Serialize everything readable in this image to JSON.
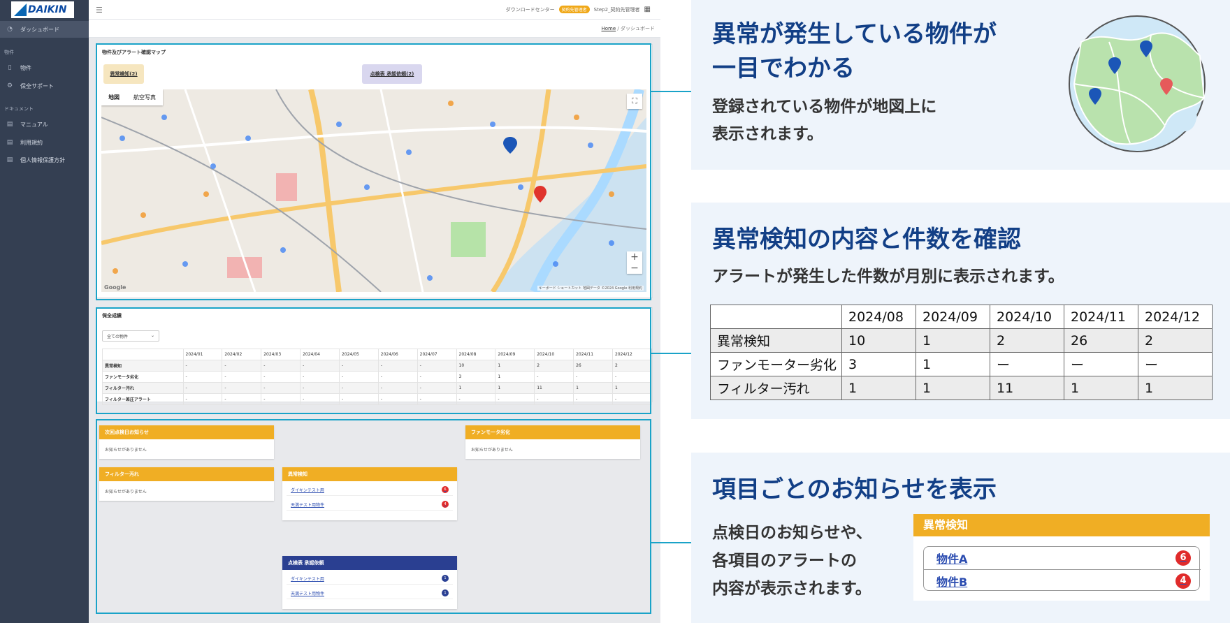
{
  "sidebar": {
    "logo": "DAIKIN",
    "items": [
      {
        "label": "ダッシュボード",
        "icon": "dashboard-icon"
      },
      {
        "label": "物件",
        "icon": "building-icon"
      },
      {
        "label": "保全サポート",
        "icon": "support-icon"
      },
      {
        "label": "マニュアル",
        "icon": "document-icon"
      },
      {
        "label": "利用規約",
        "icon": "document-icon"
      },
      {
        "label": "個人情報保護方針",
        "icon": "document-icon"
      }
    ],
    "sections": [
      "物件",
      "ドキュメント"
    ]
  },
  "topbar": {
    "download_center": "ダウンロードセンター",
    "badge": "契約先管理者",
    "user": "Step2_契約先管理者"
  },
  "breadcrumb": {
    "home": "Home",
    "sep": "/",
    "current": "ダッシュボード"
  },
  "map_card": {
    "title": "物件及びアラート確認マップ",
    "btn_anomaly": "異常検知(2)",
    "btn_inspection": "点検表 承認依頼(2)",
    "tab_map": "地図",
    "tab_satellite": "航空写真",
    "google": "Google",
    "attribution": "キーボード ショートカット  地図データ ©2024 Google  利用規約"
  },
  "maint_card": {
    "title": "保全成績",
    "select": "全ての物件",
    "months": [
      "2024/01",
      "2024/02",
      "2024/03",
      "2024/04",
      "2024/05",
      "2024/06",
      "2024/07",
      "2024/08",
      "2024/09",
      "2024/10",
      "2024/11",
      "2024/12"
    ],
    "rows": [
      {
        "label": "異常検知",
        "values": [
          "-",
          "-",
          "-",
          "-",
          "-",
          "-",
          "-",
          "10",
          "1",
          "2",
          "26",
          "2"
        ]
      },
      {
        "label": "ファンモータ劣化",
        "values": [
          "-",
          "-",
          "-",
          "-",
          "-",
          "-",
          "-",
          "3",
          "1",
          "-",
          "-",
          "-"
        ]
      },
      {
        "label": "フィルター汚れ",
        "values": [
          "-",
          "-",
          "-",
          "-",
          "-",
          "-",
          "-",
          "1",
          "1",
          "11",
          "1",
          "1"
        ]
      },
      {
        "label": "フィルター差圧アラート",
        "values": [
          "-",
          "-",
          "-",
          "-",
          "-",
          "-",
          "-",
          "-",
          "-",
          "-",
          "-",
          "-"
        ]
      }
    ]
  },
  "notices": {
    "next_inspection": {
      "title": "次回点検日お知らせ",
      "body": "お知らせがありません"
    },
    "fan_motor": {
      "title": "ファンモータ劣化",
      "body": "お知らせがありません"
    },
    "filter": {
      "title": "フィルター汚れ",
      "body": "お知らせがありません"
    },
    "anomaly": {
      "title": "異常検知",
      "links": [
        {
          "label": "ダイキンテスト用",
          "count": "6"
        },
        {
          "label": "天満テスト用物件",
          "count": "4"
        }
      ]
    },
    "inspection": {
      "title": "点検表 承認依頼",
      "links": [
        {
          "label": "ダイキンテスト用",
          "count": "1"
        },
        {
          "label": "天満テスト用物件",
          "count": "1"
        }
      ]
    }
  },
  "colors": {
    "accent": "#1aa3c8",
    "navy": "#123f86",
    "orange": "#f0ae24",
    "sidebar": "#343f52",
    "red": "#e02b2b"
  },
  "panel1": {
    "heading1": "異常が発生している物件が",
    "heading2": "一目でわかる",
    "text1": "登録されている物件が地図上に",
    "text2": "表示されます。"
  },
  "panel2": {
    "heading": "異常検知の内容と件数を確認",
    "text": "アラートが発生した件数が月別に表示されます。",
    "months": [
      "2024/08",
      "2024/09",
      "2024/10",
      "2024/11",
      "2024/12"
    ],
    "rows": [
      {
        "label": "異常検知",
        "values": [
          "10",
          "1",
          "2",
          "26",
          "2"
        ]
      },
      {
        "label": "ファンモーター劣化",
        "values": [
          "3",
          "1",
          "ー",
          "ー",
          "ー"
        ]
      },
      {
        "label": "フィルター汚れ",
        "values": [
          "1",
          "1",
          "11",
          "1",
          "1"
        ]
      }
    ]
  },
  "panel3": {
    "heading": "項目ごとのお知らせを表示",
    "text1": "点検日のお知らせや、",
    "text2": "各項目のアラートの",
    "text3": "内容が表示されます。",
    "sample_title": "異常検知",
    "sample_links": [
      {
        "label": "物件A",
        "count": "6"
      },
      {
        "label": "物件B",
        "count": "4"
      }
    ]
  }
}
